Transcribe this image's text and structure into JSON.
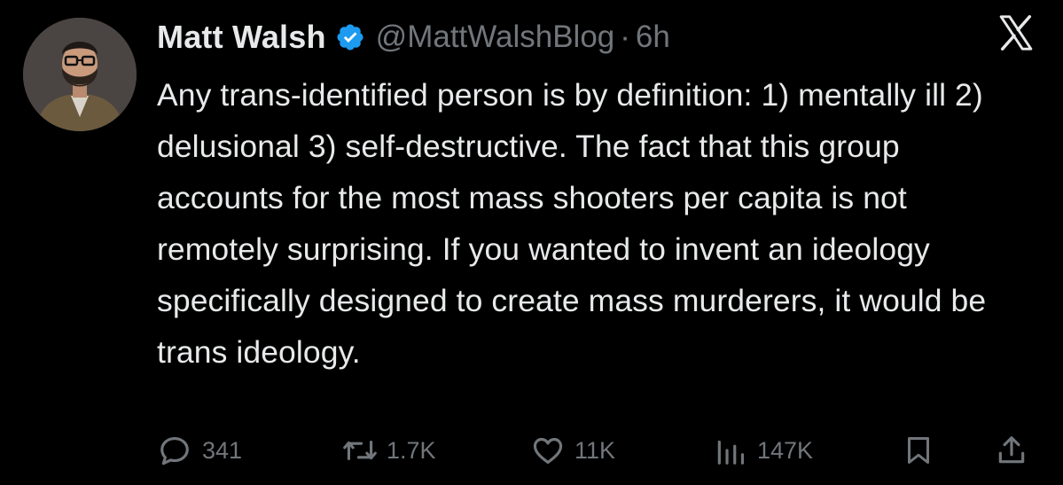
{
  "tweet": {
    "display_name": "Matt Walsh",
    "handle": "@MattWalshBlog",
    "separator": "·",
    "time": "6h",
    "verified_icon": "verified-badge-icon",
    "verified_color": "#1d9bf0",
    "platform_logo": "x-logo-icon",
    "text": "Any trans-identified person is by definition: 1) mentally ill 2) delusional 3) self-destructive. The fact that this group accounts for the most mass shooters per capita is not remotely surprising. If you wanted to invent an ideology specifically designed to create mass murderers, it would be trans ideology."
  },
  "actions": {
    "replies": {
      "icon": "reply-icon",
      "count": "341"
    },
    "reposts": {
      "icon": "repost-icon",
      "count": "1.7K"
    },
    "likes": {
      "icon": "like-icon",
      "count": "11K"
    },
    "views": {
      "icon": "views-icon",
      "count": "147K"
    },
    "bookmark": {
      "icon": "bookmark-icon"
    },
    "share": {
      "icon": "share-icon"
    }
  },
  "colors": {
    "background": "#000000",
    "primary_text": "#e7e9ea",
    "secondary_text": "#71767b"
  }
}
